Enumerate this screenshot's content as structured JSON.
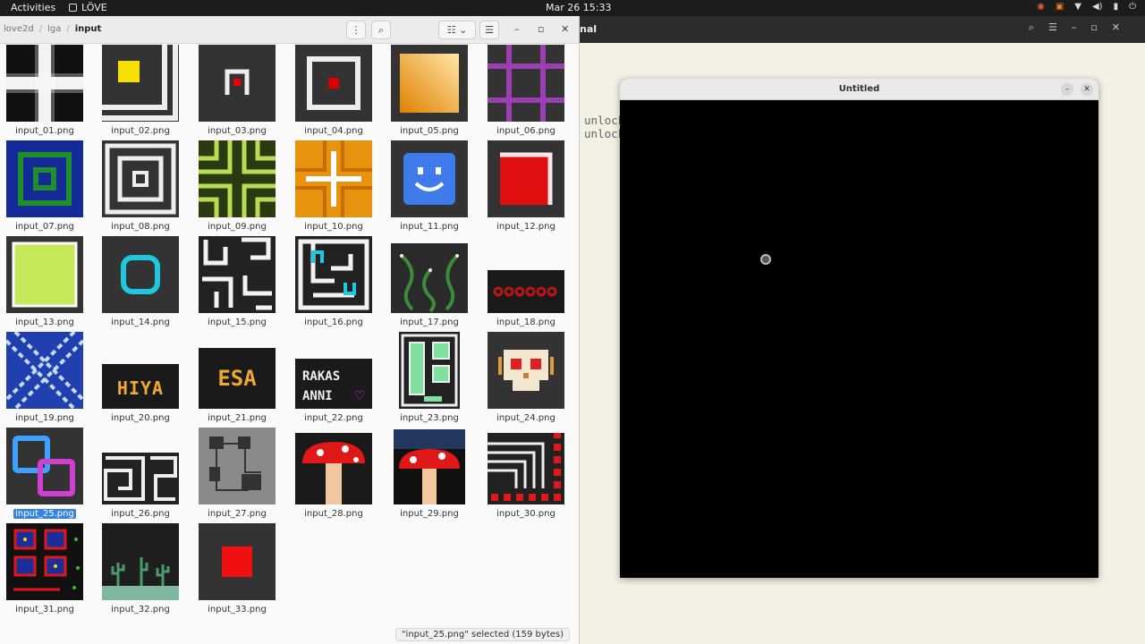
{
  "topbar": {
    "activities": "Activities",
    "app_name": "LÖVE",
    "clock": "Mar 26  15:33"
  },
  "terminal": {
    "title_fragment": "nal",
    "lines": [
      "unlock",
      "unlock"
    ]
  },
  "files": {
    "breadcrumbs": [
      "love2d",
      "lga",
      "input"
    ],
    "files": [
      "input_01.png",
      "input_02.png",
      "input_03.png",
      "input_04.png",
      "input_05.png",
      "input_06.png",
      "input_07.png",
      "input_08.png",
      "input_09.png",
      "input_10.png",
      "input_11.png",
      "input_12.png",
      "input_13.png",
      "input_14.png",
      "input_15.png",
      "input_16.png",
      "input_17.png",
      "input_18.png",
      "input_19.png",
      "input_20.png",
      "input_21.png",
      "input_22.png",
      "input_23.png",
      "input_24.png",
      "input_25.png",
      "input_26.png",
      "input_27.png",
      "input_28.png",
      "input_29.png",
      "input_30.png",
      "input_31.png",
      "input_32.png",
      "input_33.png"
    ],
    "selected_file": "input_25.png",
    "status": "\"input_25.png\" selected  (159 bytes)",
    "thumb_text": {
      "t20": "HIYA",
      "t21": "ESA",
      "t22a": "RAKAS",
      "t22b": "ANNI"
    }
  },
  "love_window": {
    "title": "Untitled"
  }
}
